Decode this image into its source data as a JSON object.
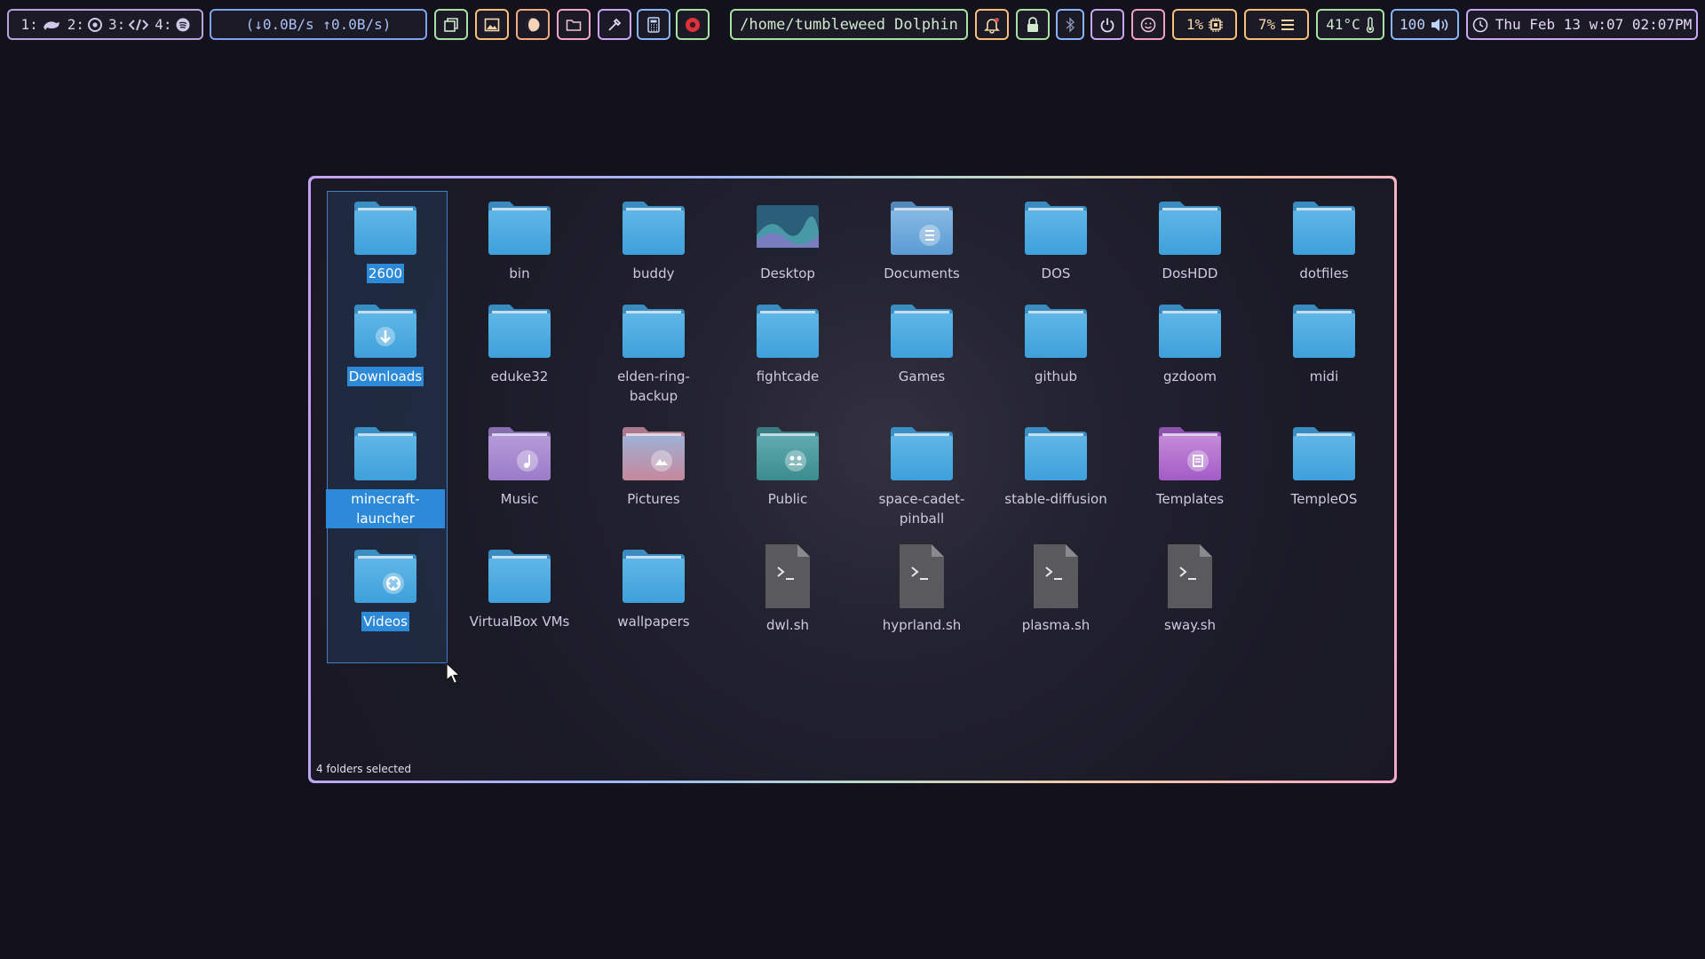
{
  "topbar": {
    "workspaces": [
      {
        "num": "1:",
        "icon": "chameleon-icon"
      },
      {
        "num": "2:",
        "icon": "chrome-icon"
      },
      {
        "num": "3:",
        "icon": "code-icon"
      },
      {
        "num": "4:",
        "icon": "spotify-icon"
      }
    ],
    "network": "(↓0.0B/s ↑0.0B/s)",
    "launchers": [
      "windows-icon",
      "image-viewer-icon",
      "moon-icon",
      "folder-icon",
      "color-picker-icon",
      "calculator-icon",
      "record-icon"
    ],
    "active_window": "/home/tumbleweed Dolphin",
    "cpu": "1%",
    "memory": "7%",
    "temperature": "41°C",
    "volume": "100",
    "datetime": "Thu Feb 13 w:07 02:07PM"
  },
  "window": {
    "items": [
      {
        "label": "2600",
        "type": "folder",
        "selected": true
      },
      {
        "label": "bin",
        "type": "folder"
      },
      {
        "label": "buddy",
        "type": "folder"
      },
      {
        "label": "Desktop",
        "type": "desktop"
      },
      {
        "label": "Documents",
        "type": "documents"
      },
      {
        "label": "DOS",
        "type": "folder"
      },
      {
        "label": "DosHDD",
        "type": "folder"
      },
      {
        "label": "dotfiles",
        "type": "folder"
      },
      {
        "label": "Downloads",
        "type": "downloads",
        "selected": true
      },
      {
        "label": "eduke32",
        "type": "folder"
      },
      {
        "label": "elden-ring-backup",
        "type": "folder"
      },
      {
        "label": "fightcade",
        "type": "folder"
      },
      {
        "label": "Games",
        "type": "folder"
      },
      {
        "label": "github",
        "type": "folder"
      },
      {
        "label": "gzdoom",
        "type": "folder"
      },
      {
        "label": "midi",
        "type": "folder"
      },
      {
        "label": "minecraft-launcher",
        "type": "folder",
        "selected": true
      },
      {
        "label": "Music",
        "type": "music"
      },
      {
        "label": "Pictures",
        "type": "pictures"
      },
      {
        "label": "Public",
        "type": "public"
      },
      {
        "label": "space-cadet-pinball",
        "type": "folder"
      },
      {
        "label": "stable-diffusion",
        "type": "folder"
      },
      {
        "label": "Templates",
        "type": "templates"
      },
      {
        "label": "TempleOS",
        "type": "folder"
      },
      {
        "label": "Videos",
        "type": "videos",
        "selected": true
      },
      {
        "label": "VirtualBox VMs",
        "type": "folder"
      },
      {
        "label": "wallpapers",
        "type": "folder"
      },
      {
        "label": "dwl.sh",
        "type": "script"
      },
      {
        "label": "hyprland.sh",
        "type": "script"
      },
      {
        "label": "plasma.sh",
        "type": "script"
      },
      {
        "label": "sway.sh",
        "type": "script"
      }
    ],
    "status": "4 folders selected"
  },
  "colors": {
    "folder": "#3ea0db",
    "selection": "#2d8ad8",
    "background": "#13121c"
  }
}
